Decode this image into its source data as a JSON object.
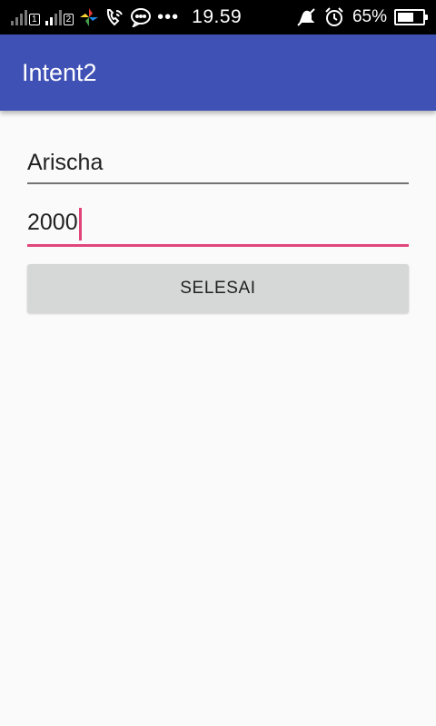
{
  "status_bar": {
    "time": "19.59",
    "battery_percent": "65%",
    "battery_level": 0.65,
    "sim1_label": "1",
    "sim2_label": "2",
    "more_glyph": "•••",
    "icons": [
      "signal-sim1-icon",
      "signal-sim2-icon",
      "pinwheel-app-icon",
      "wifi-call-icon",
      "chat-icon",
      "more-dots-icon",
      "mute-icon",
      "alarm-icon",
      "battery-icon"
    ]
  },
  "app_bar": {
    "title": "Intent2",
    "color": "#3f51b5"
  },
  "form": {
    "name_value": "Arischa",
    "year_value": "2000",
    "submit_label": "SELESAI",
    "accent_color": "#e0457b"
  }
}
